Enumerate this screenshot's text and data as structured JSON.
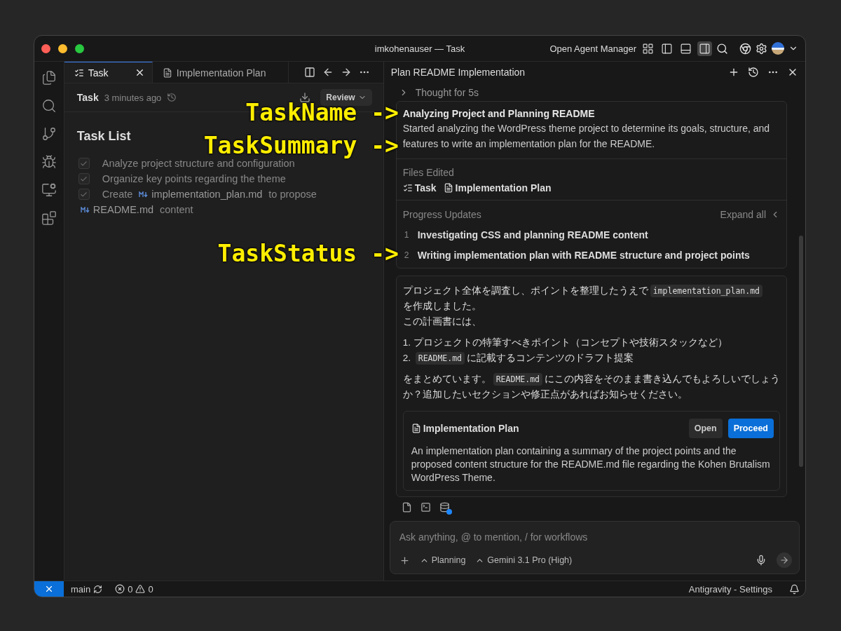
{
  "window": {
    "title": "imkohenauser — Task",
    "agent_manager": "Open Agent Manager",
    "layout_toggles": [
      {
        "kind": "grid",
        "selected": false
      },
      {
        "kind": "left",
        "selected": false
      },
      {
        "kind": "bottom",
        "selected": false
      },
      {
        "kind": "right",
        "selected": true
      }
    ]
  },
  "editor": {
    "tabs": [
      {
        "kind": "task",
        "label": "Task",
        "selected": true
      },
      {
        "kind": "doc",
        "label": "Implementation Plan",
        "selected": false
      }
    ],
    "header": {
      "title": "Task",
      "time": "3 minutes ago",
      "review": "Review"
    },
    "heading": "Task List",
    "items": [
      {
        "checked": true,
        "parts": [
          {
            "kind": "text",
            "text": "Analyze project structure and configuration"
          }
        ]
      },
      {
        "checked": true,
        "parts": [
          {
            "kind": "text",
            "text": "Organize key points regarding the theme"
          }
        ]
      },
      {
        "checked": true,
        "parts": [
          {
            "kind": "text",
            "text": "Create"
          },
          {
            "kind": "file",
            "text": "implementation_plan.md"
          },
          {
            "kind": "text",
            "text": "to propose"
          },
          {
            "kind": "file",
            "text": "README.md"
          },
          {
            "kind": "text",
            "text": "content"
          }
        ]
      }
    ]
  },
  "agent": {
    "title": "Plan README Implementation",
    "thought": "Thought for 5s",
    "task": {
      "name": "Analyzing Project and Planning README",
      "summary": "Started analyzing the WordPress theme project to determine its goals, structure, and features to write an implementation plan for the README.",
      "files_label": "Files Edited",
      "files": [
        {
          "kind": "task",
          "label": "Task"
        },
        {
          "kind": "doc",
          "label": "Implementation Plan"
        }
      ],
      "progress_label": "Progress Updates",
      "expand": "Expand all",
      "updates": [
        {
          "number": "1",
          "text": "Investigating CSS and planning README content"
        },
        {
          "number": "2",
          "text": "Writing implementation plan with README structure and project points"
        }
      ]
    },
    "message": [
      {
        "kind": "para",
        "lines": [
          [
            {
              "kind": "text",
              "text": "プロジェクト全体を調査し、ポイントを整理したうえで"
            },
            {
              "kind": "code",
              "text": "implementation_plan.md"
            }
          ],
          [
            {
              "kind": "text",
              "text": "を作成しました。"
            }
          ],
          [
            {
              "kind": "text",
              "text": "この計画書には、"
            }
          ]
        ]
      },
      {
        "kind": "list",
        "items": [
          {
            "number": "1.",
            "parts": [
              {
                "kind": "text",
                "text": "プロジェクトの特筆すべきポイント（コンセプトや技術スタックなど）"
              }
            ]
          },
          {
            "number": "2.",
            "parts": [
              {
                "kind": "code",
                "text": "README.md"
              },
              {
                "kind": "text",
                "text": "に記載するコンテンツのドラフト提案"
              }
            ]
          }
        ]
      },
      {
        "kind": "para",
        "lines": [
          [
            {
              "kind": "text",
              "text": "をまとめています。"
            },
            {
              "kind": "code",
              "text": "README.md"
            },
            {
              "kind": "text",
              "text": "にこの内容をそのまま書き込んでもよろしいでしょう"
            }
          ],
          [
            {
              "kind": "text",
              "text": "か？追加したいセクションや修正点があればお知らせください。"
            }
          ]
        ]
      }
    ],
    "artifact": {
      "title": "Implementation Plan",
      "open": "Open",
      "proceed": "Proceed",
      "description": "An implementation plan containing a summary of the project points and the proposed content structure for the README.md file regarding the Kohen Brutalism WordPress Theme."
    },
    "input": {
      "placeholder": "Ask anything, @ to mention, / for workflows",
      "mode": "Planning",
      "model": "Gemini 3.1 Pro (High)"
    }
  },
  "status_bar": {
    "branch": "main",
    "errors": "0",
    "warnings": "0",
    "settings": "Antigravity - Settings"
  },
  "annotations": [
    {
      "label": "TaskName",
      "arrow": "->"
    },
    {
      "label": "TaskSummary",
      "arrow": "->"
    },
    {
      "label": "TaskStatus",
      "arrow": "->"
    }
  ]
}
